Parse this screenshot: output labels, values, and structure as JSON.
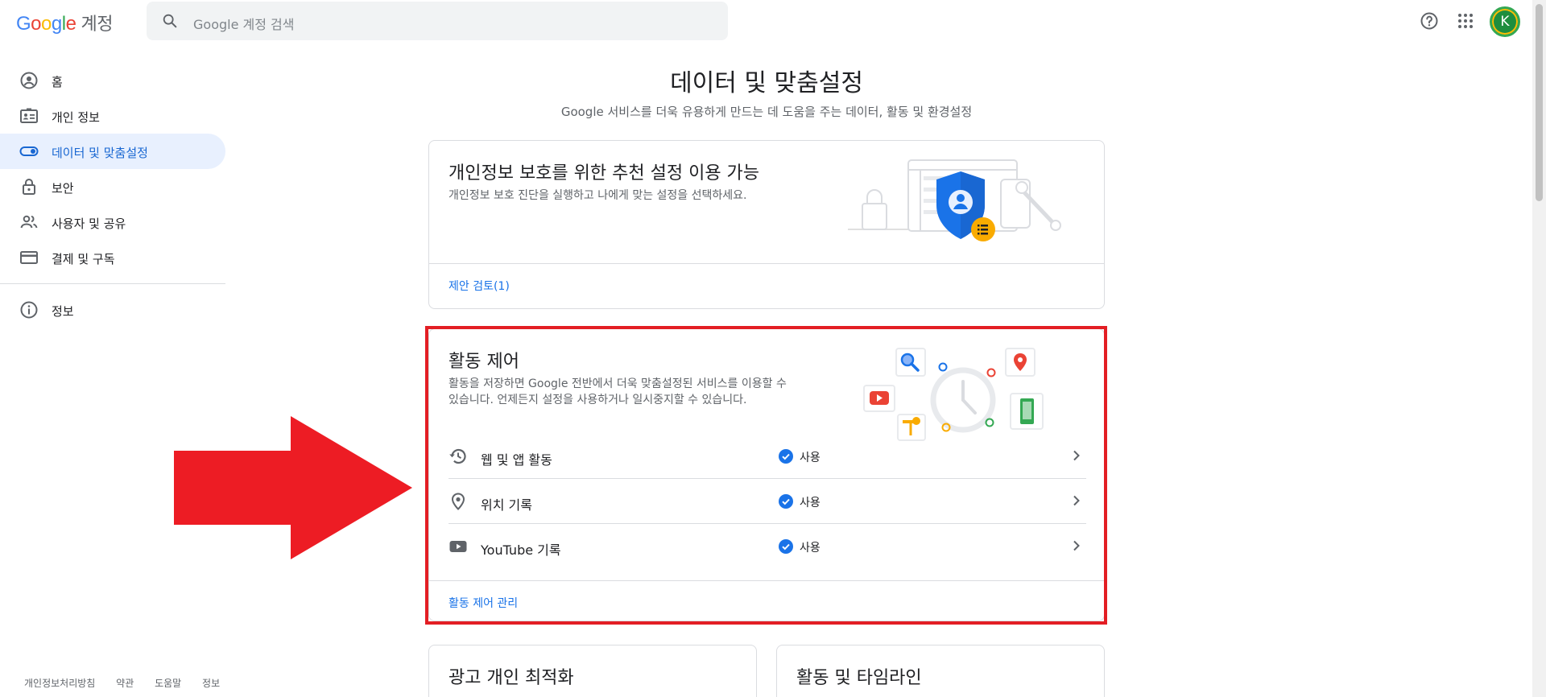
{
  "header": {
    "logo_text": "Google",
    "account_label": "계정",
    "search_placeholder": "Google 계정 검색",
    "avatar_initial": "K"
  },
  "sidebar": {
    "items": [
      {
        "label": "홈",
        "icon": "person-circle-icon"
      },
      {
        "label": "개인 정보",
        "icon": "id-card-icon"
      },
      {
        "label": "데이터 및 맞춤설정",
        "icon": "toggle-icon",
        "active": true
      },
      {
        "label": "보안",
        "icon": "lock-icon"
      },
      {
        "label": "사용자 및 공유",
        "icon": "people-icon"
      },
      {
        "label": "결제 및 구독",
        "icon": "credit-card-icon"
      }
    ],
    "info_label": "정보"
  },
  "footer": {
    "links": [
      "개인정보처리방침",
      "약관",
      "도움말",
      "정보"
    ]
  },
  "main": {
    "title": "데이터 및 맞춤설정",
    "subtitle": "Google 서비스를 더욱 유용하게 만드는 데 도움을 주는 데이터, 활동 및 환경설정",
    "privacy_card": {
      "title": "개인정보 보호를 위한 추천 설정 이용 가능",
      "desc": "개인정보 보호 진단을 실행하고 나에게 맞는 설정을 선택하세요.",
      "link": "제안 검토(1)"
    },
    "activity_card": {
      "title": "활동 제어",
      "desc_line1": "활동을 저장하면 Google 전반에서 더욱 맞춤설정된 서비스를 이용할 수",
      "desc_line2": "있습니다. 언제든지 설정을 사용하거나 일시중지할 수 있습니다.",
      "rows": [
        {
          "label": "웹 및 앱 활동",
          "status": "사용",
          "icon": "history-icon"
        },
        {
          "label": "위치 기록",
          "status": "사용",
          "icon": "location-pin-icon"
        },
        {
          "label": "YouTube 기록",
          "status": "사용",
          "icon": "youtube-icon"
        }
      ],
      "link": "활동 제어 관리"
    },
    "ads_card": {
      "title": "광고 개인 최적화"
    },
    "timeline_card": {
      "title": "활동 및 타임라인"
    }
  },
  "colors": {
    "accent": "#1a73e8",
    "highlight_frame": "#e31e24",
    "arrow": "#ed1c24"
  }
}
